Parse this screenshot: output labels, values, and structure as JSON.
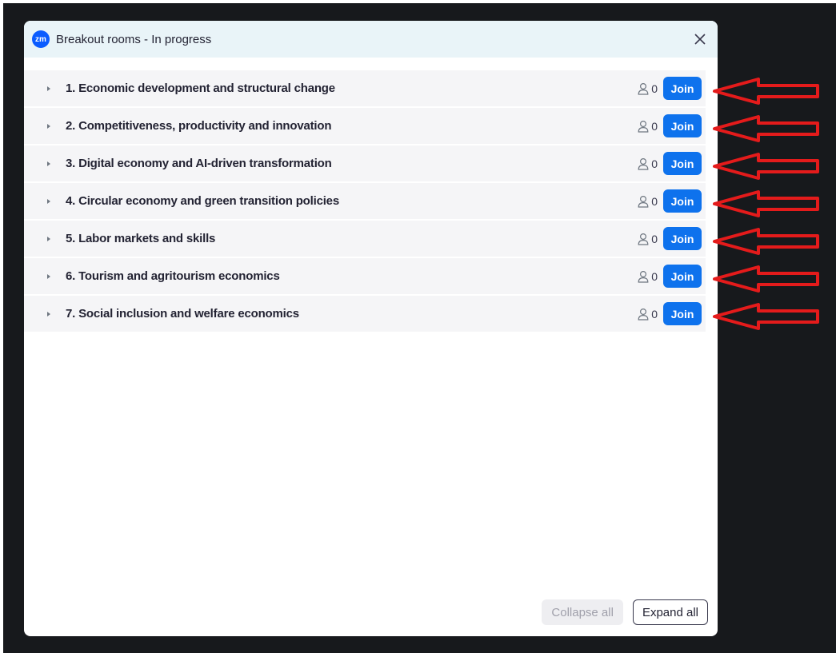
{
  "window": {
    "title": "Breakout rooms - In progress",
    "logo_text": "zm"
  },
  "rooms": [
    {
      "name": "1. Economic development and structural change",
      "count": "0",
      "join_label": "Join"
    },
    {
      "name": "2. Competitiveness, productivity and innovation",
      "count": "0",
      "join_label": "Join"
    },
    {
      "name": "3. Digital economy and AI-driven transformation",
      "count": "0",
      "join_label": "Join"
    },
    {
      "name": "4. Circular economy and green transition policies",
      "count": "0",
      "join_label": "Join"
    },
    {
      "name": "5. Labor markets and skills",
      "count": "0",
      "join_label": "Join"
    },
    {
      "name": "6. Tourism and agritourism economics",
      "count": "0",
      "join_label": "Join"
    },
    {
      "name": "7. Social inclusion and welfare economics",
      "count": "0",
      "join_label": "Join"
    }
  ],
  "footer": {
    "collapse_label": "Collapse all",
    "expand_label": "Expand all"
  },
  "icons": {
    "logo": "zoom-logo-icon",
    "close": "close-icon",
    "expand": "chevron-right-icon",
    "participants": "person-icon",
    "annotation": "red-arrow-icon"
  },
  "colors": {
    "accent": "#0e72ed",
    "backdrop": "#17191c",
    "titlebar": "#e9f4f8",
    "row": "#f5f5f7",
    "annotation": "#e41b1b"
  }
}
